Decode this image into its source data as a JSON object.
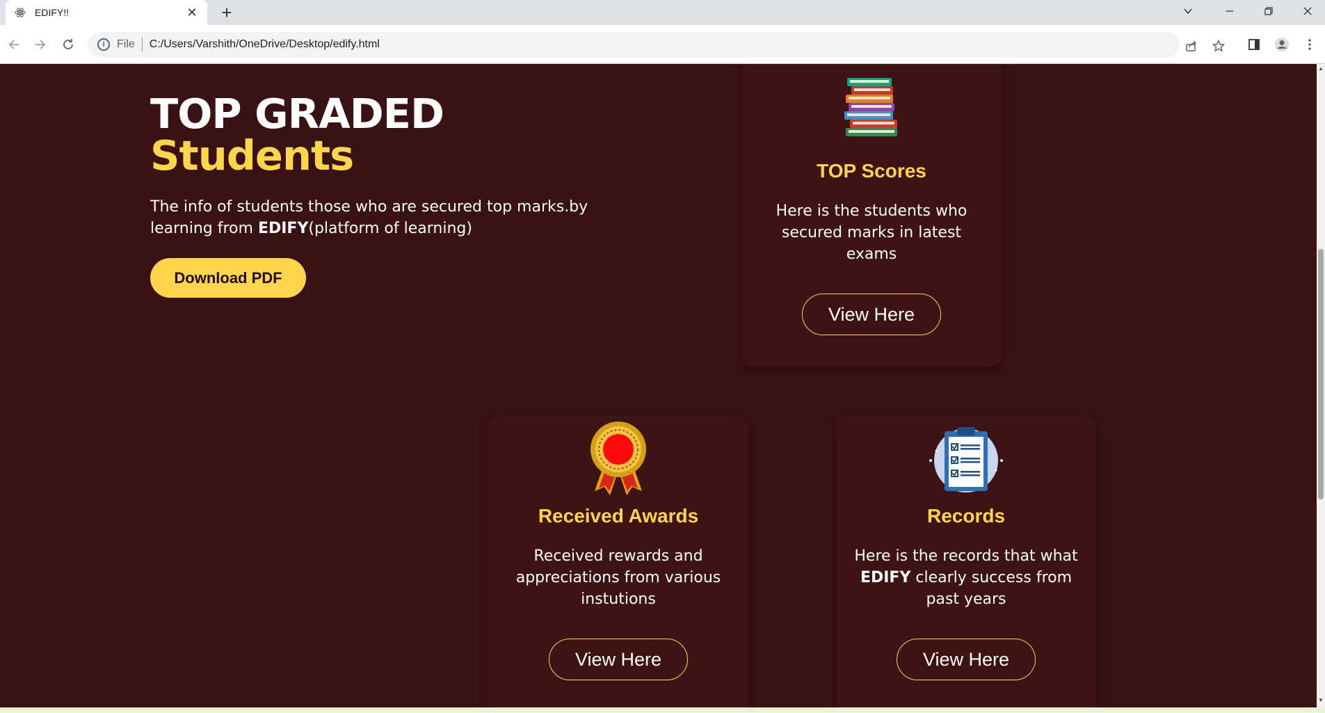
{
  "browser": {
    "tab_title": "EDIFY!!",
    "tab_close": "✕",
    "new_tab": "+",
    "scheme_label": "File",
    "url": "C:/Users/Varshith/OneDrive/Desktop/edify.html"
  },
  "hero": {
    "title": "TOP GRADED",
    "title_accent": "Students",
    "desc_pre": "The info of students those who are secured top marks.by learning from ",
    "desc_brand": "EDIFY",
    "desc_post": "(platform of learning)",
    "download_label": "Download PDF"
  },
  "cards": {
    "top_scores": {
      "icon": "books-stack-icon",
      "title": "TOP Scores",
      "text": "Here is the students who secured marks in latest exams",
      "button": "View Here"
    },
    "awards": {
      "icon": "award-ribbon-icon",
      "title": "Received Awards",
      "text": "Received rewards and appreciations from various instutions",
      "button": "View Here"
    },
    "records": {
      "icon": "clipboard-checklist-icon",
      "title": "Records",
      "text_pre": "Here is the records that what ",
      "text_brand": "EDIFY",
      "text_post": " clearly success from past years",
      "button": "View Here"
    }
  },
  "colors": {
    "background": "#3a1213",
    "accent": "#ffd54a",
    "card": "#3d1314"
  }
}
